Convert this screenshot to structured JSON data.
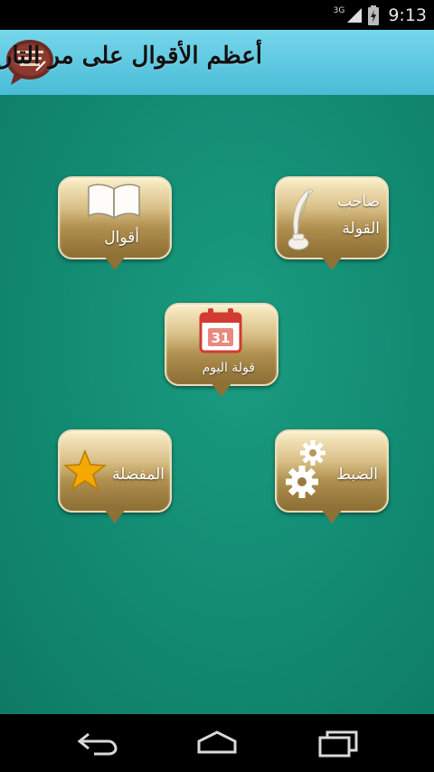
{
  "status_bar": {
    "network_label": "3G",
    "time": "9:13",
    "icons": [
      "signal-icon",
      "battery-charging-icon"
    ]
  },
  "action_bar": {
    "title": "أعظم الأقوال على مر التاريخ",
    "app_icon": "quote-bubble-app-icon",
    "colors": {
      "background": "#5ccae2"
    }
  },
  "menu": {
    "tiles": [
      {
        "id": "author",
        "label_line1": "صاحب",
        "label_line2": "القولة",
        "icon": "quill-inkwell-icon"
      },
      {
        "id": "quotes",
        "label": "أقوال",
        "icon": "open-book-icon"
      },
      {
        "id": "daily",
        "label": "قولة اليوم",
        "icon": "calendar-icon",
        "calendar_day": "31"
      },
      {
        "id": "settings",
        "label": "الضبط",
        "icon": "gear-icon"
      },
      {
        "id": "favorites",
        "label": "المفضلة",
        "icon": "star-icon"
      }
    ],
    "colors": {
      "background": "#128a72",
      "tile": "#c8a96a",
      "star": "#f5a800",
      "calendar": "#d23a32"
    }
  },
  "nav_bar": {
    "buttons": [
      "back-icon",
      "home-icon",
      "recent-apps-icon"
    ]
  }
}
